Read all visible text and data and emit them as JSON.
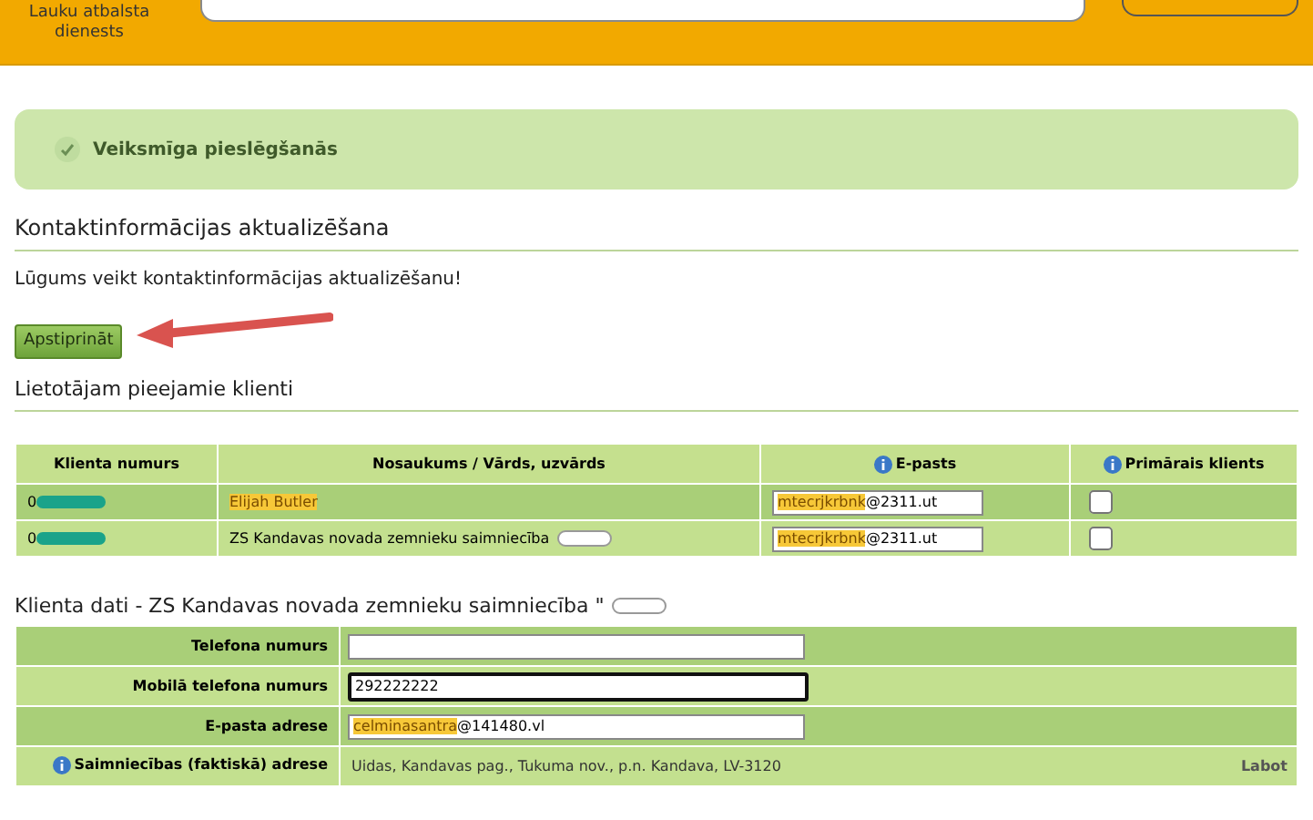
{
  "header": {
    "logo_lines": [
      "Lauku atbalsta",
      "dienests"
    ]
  },
  "alert": {
    "text": "Veiksmīga pieslēgšanās"
  },
  "title": "Kontaktinformācijas aktualizēšana",
  "message": "Lūgums veikt kontaktinformācijas aktualizēšanu!",
  "confirm_button": "Apstiprināt",
  "clients_heading": "Lietotājam pieejamie klienti",
  "clients_table": {
    "columns": [
      {
        "label": "Klienta numurs",
        "info": false
      },
      {
        "label": "Nosaukums / Vārds, uzvārds",
        "info": false
      },
      {
        "label": "E-pasts",
        "info": true
      },
      {
        "label": "Primārais klients",
        "info": true
      }
    ],
    "rows": [
      {
        "number": "0",
        "name": "Elijah Butler",
        "name_highlighted": true,
        "name_redacted": false,
        "email_user": "mtecrjkrbnk",
        "email_domain": "@2311.ut",
        "primary": false
      },
      {
        "number": "0",
        "name": "ZS Kandavas novada zemnieku saimniecība",
        "name_highlighted": false,
        "name_redacted": true,
        "email_user": "mtecrjkrbnk",
        "email_domain": "@2311.ut",
        "primary": false
      }
    ]
  },
  "details": {
    "heading": "Klienta dati - ZS Kandavas novada zemnieku saimniecība \"",
    "fields": [
      {
        "kind": "input",
        "label": "Telefona numurs",
        "focused": false
      },
      {
        "kind": "input",
        "label": "Mobilā telefona numurs",
        "value": "292222222",
        "focused": true
      },
      {
        "kind": "email",
        "label": "E-pasta adrese",
        "user": "celminasantra",
        "domain": "@141480.vl",
        "focused": false
      },
      {
        "kind": "text",
        "label": "Saimniecības (faktiskā) adrese",
        "info": true,
        "value": "Uidas, Kandavas pag., Tukuma nov., p.n. Kandava, LV-3120",
        "action": "Labot"
      }
    ]
  }
}
